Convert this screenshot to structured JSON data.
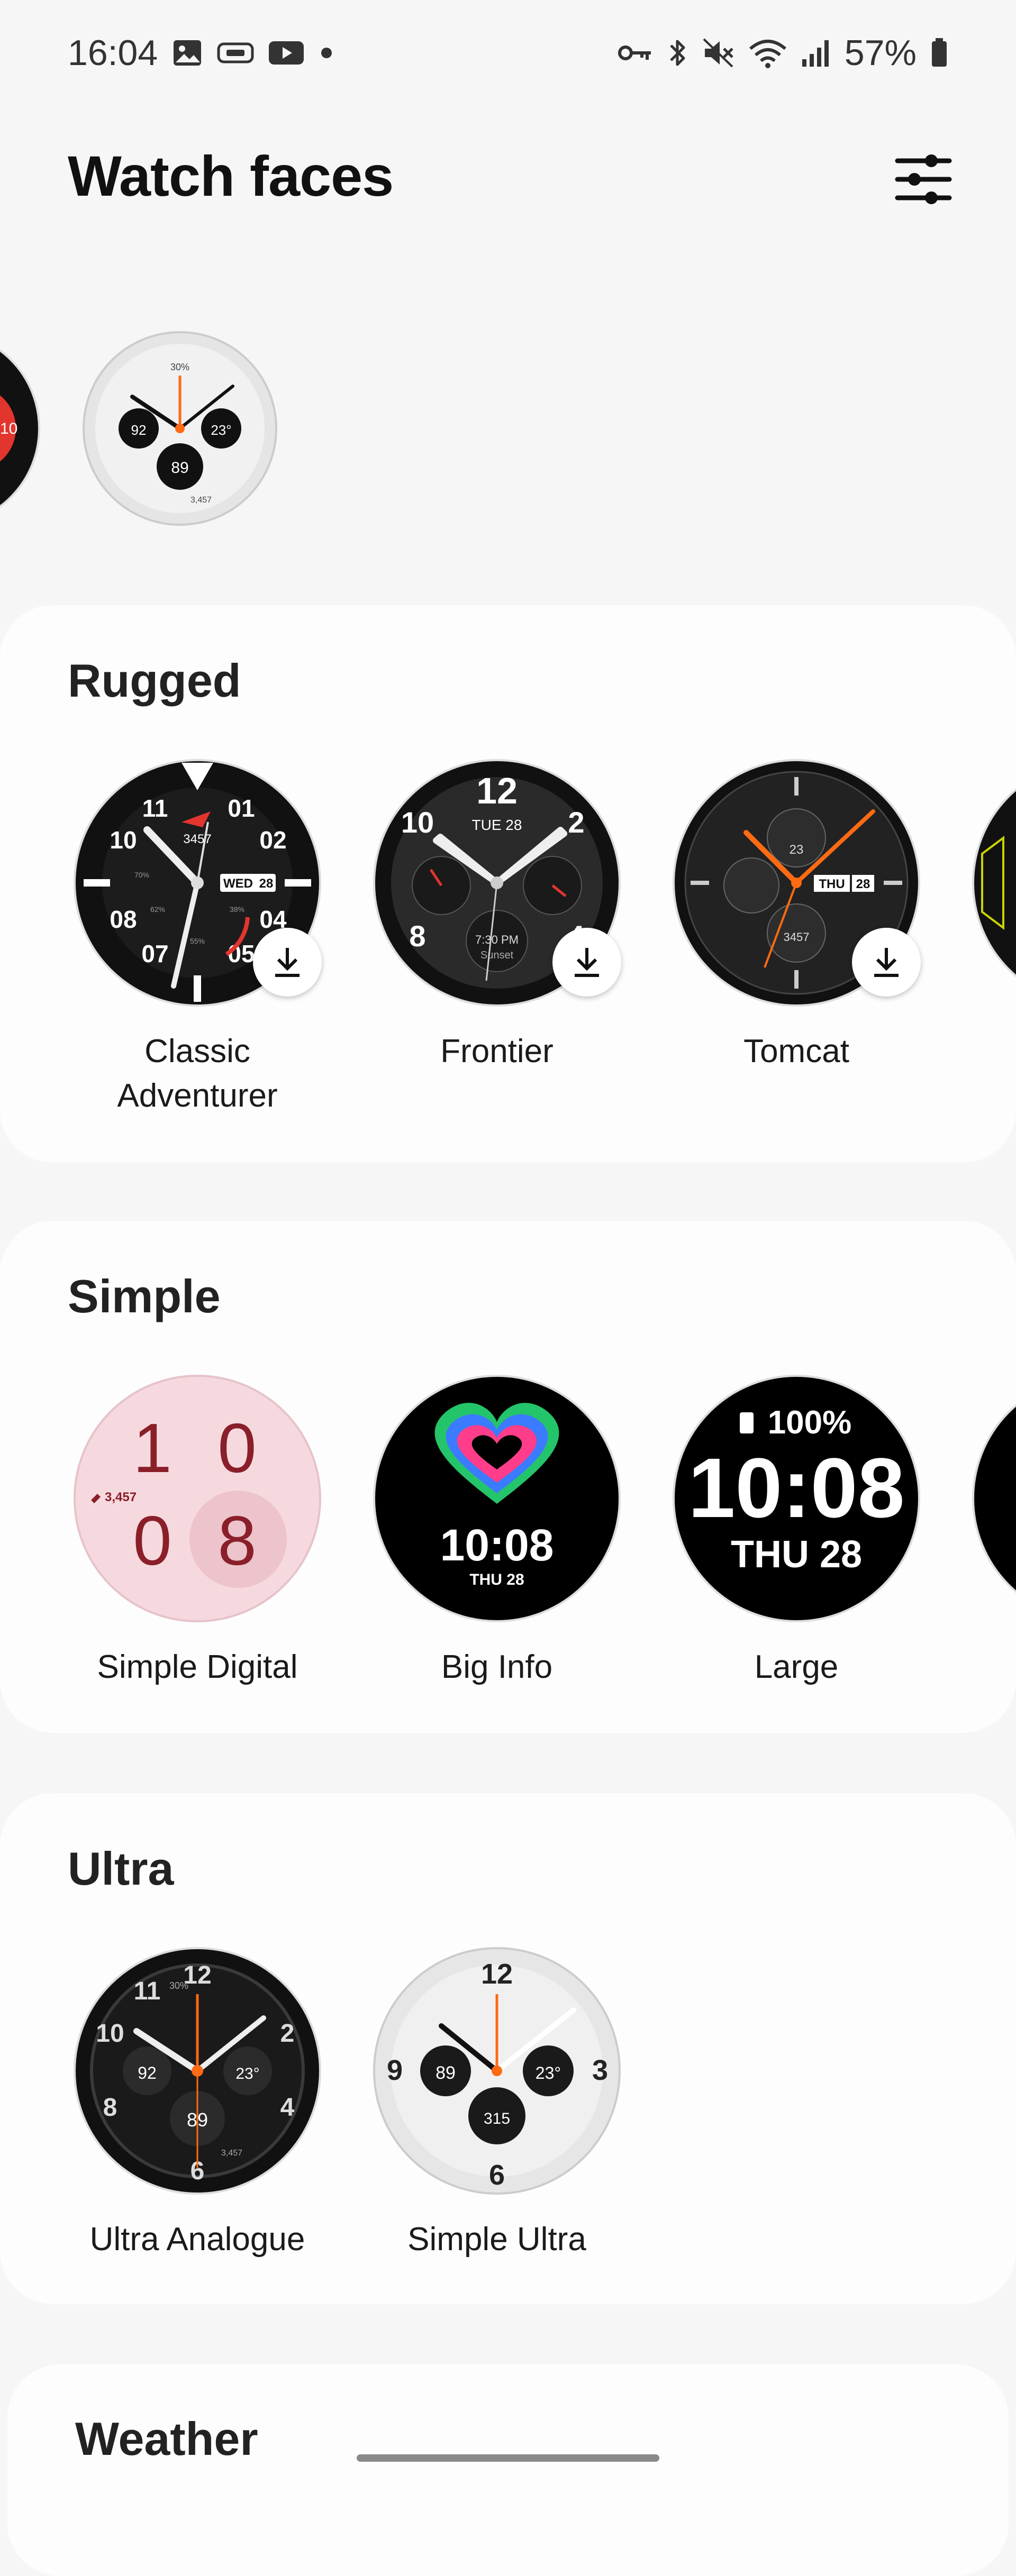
{
  "status_bar": {
    "time": "16:04",
    "left_icons": [
      "gallery-icon",
      "video-chip-icon",
      "youtube-icon",
      "dot-icon"
    ],
    "right_icons": [
      "vpn-key-icon",
      "bluetooth-icon",
      "mute-icon",
      "wifi-icon",
      "signal-icon",
      "battery-icon"
    ],
    "battery": "57%"
  },
  "header": {
    "title": "Watch faces",
    "filter_icon": "sliders-icon"
  },
  "recent": {
    "faces": [
      {
        "values": [
          "10"
        ]
      },
      {
        "values": [
          "92",
          "23°",
          "89",
          "30%",
          "3,457"
        ]
      }
    ]
  },
  "sections": [
    {
      "title": "Rugged",
      "faces": [
        {
          "name": "Classic Adventurer",
          "download": true,
          "values": [
            "11",
            "01",
            "10",
            "02",
            "08",
            "04",
            "07",
            "05",
            "3457",
            "WED",
            "28",
            "70%",
            "62%",
            "38%",
            "55%"
          ]
        },
        {
          "name": "Frontier",
          "download": true,
          "values": [
            "12",
            "TUE 28",
            "10",
            "2",
            "8",
            "4",
            "7:30 PM",
            "Sunset"
          ]
        },
        {
          "name": "Tomcat",
          "download": true,
          "values": [
            "23",
            "THU",
            "28",
            "3457"
          ]
        }
      ]
    },
    {
      "title": "Simple",
      "faces": [
        {
          "name": "Simple Digital",
          "download": false,
          "values": [
            "1",
            "0",
            "0",
            "8",
            "3,457"
          ]
        },
        {
          "name": "Big Info",
          "download": false,
          "values": [
            "10:08",
            "THU 28"
          ]
        },
        {
          "name": "Large",
          "download": false,
          "values": [
            "100%",
            "10:08",
            "THU 28"
          ]
        }
      ]
    },
    {
      "title": "Ultra",
      "faces": [
        {
          "name": "Ultra Analogue",
          "download": false,
          "values": [
            "12",
            "10",
            "11",
            "2",
            "8",
            "4",
            "6",
            "92",
            "23°",
            "89",
            "30%",
            "3,457"
          ]
        },
        {
          "name": "Simple Ultra",
          "download": false,
          "values": [
            "12",
            "9",
            "3",
            "6",
            "89",
            "23°",
            "315"
          ]
        }
      ]
    },
    {
      "title": "Weather",
      "faces": []
    }
  ],
  "colors": {
    "accent_orange": "#ff6a13",
    "accent_red": "#e2352e",
    "simple_pink": "#f6d9de",
    "simple_maroon": "#8a1f2a"
  }
}
